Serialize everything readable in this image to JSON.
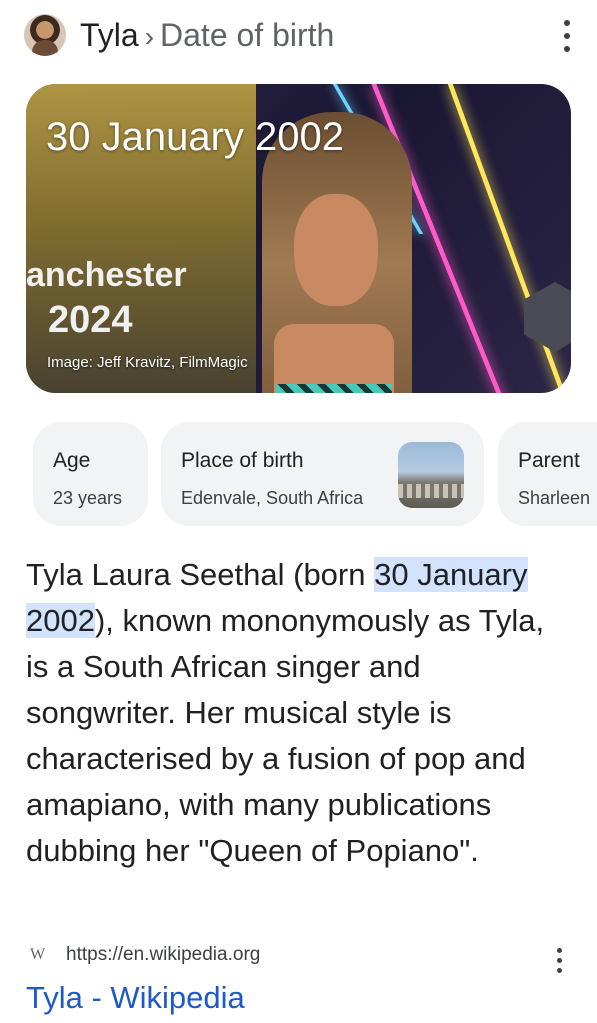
{
  "header": {
    "entity": "Tyla",
    "separator": "›",
    "attribute": "Date of birth"
  },
  "hero": {
    "title": "30 January 2002",
    "background_text_top": "anchester",
    "background_text_year": "2024",
    "credit": "Image: Jeff Kravitz, FilmMagic"
  },
  "chips": [
    {
      "key": "Age",
      "value": "23 years"
    },
    {
      "key": "Place of birth",
      "value": "Edenvale, South Africa"
    },
    {
      "key": "Parent",
      "value": "Sharleen"
    }
  ],
  "snippet": {
    "before": "Tyla Laura Seethal (born ",
    "highlight": "30 January 2002",
    "after": "), known mononymously as Tyla, is a South African singer and songwriter. Her musical style is characterised by a fusion of pop and amapiano, with many publications dubbing her \"Queen of Popiano\"."
  },
  "source": {
    "icon_letter": "W",
    "url": "https://en.wikipedia.org",
    "title": "Tyla - Wikipedia"
  },
  "colors": {
    "link": "#1f59c7",
    "highlight": "#d3e3fd",
    "chip_bg": "#f1f3f4"
  }
}
